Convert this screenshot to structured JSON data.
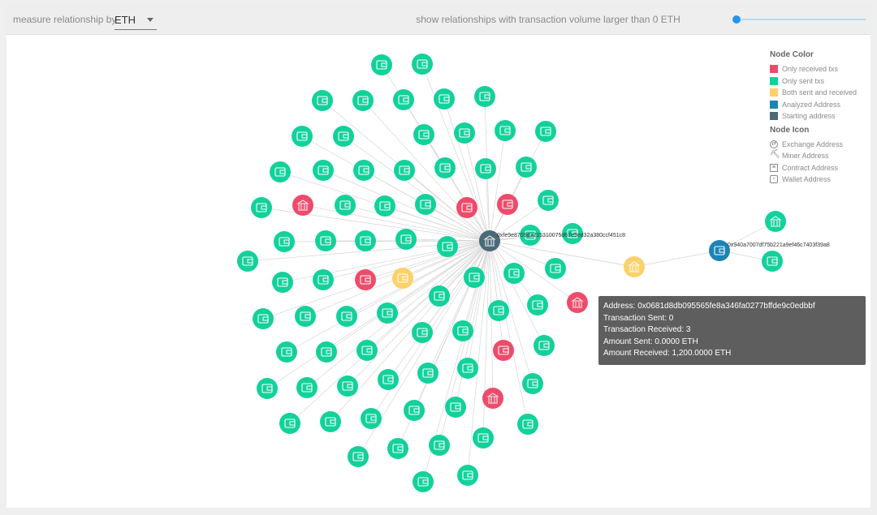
{
  "toolbar": {
    "measure_label": "measure relationship by",
    "measure_value": "ETH",
    "volume_text": "show relationships with transaction volume larger than 0 ETH",
    "slider_value": 0
  },
  "legend": {
    "color_title": "Node Color",
    "colors": [
      {
        "label": "Only received txs",
        "color": "#ee4b6b"
      },
      {
        "label": "Only sent txs",
        "color": "#13d19b"
      },
      {
        "label": "Both sent and received",
        "color": "#fcd06b"
      },
      {
        "label": "Analyzed Address",
        "color": "#1a85b4"
      },
      {
        "label": "Starting address",
        "color": "#4a6a77"
      }
    ],
    "icon_title": "Node Icon",
    "icons": [
      {
        "label": "Exchange Address",
        "icon": "exchange-icon"
      },
      {
        "label": "Miner Address",
        "icon": "miner-icon"
      },
      {
        "label": "Contract Address",
        "icon": "contract-icon"
      },
      {
        "label": "Wallet Address",
        "icon": "wallet-icon"
      }
    ]
  },
  "graph": {
    "hub_label": "0xfe9e8709d3215310075d67e3ed32a380ccf451c8",
    "analyzed_label": "0x940a7007df75b221a9ef46c7403f39a8"
  },
  "tooltip": {
    "address": "Address: 0x0681d8db095565fe8a346fa0277bffde9c0edbbf",
    "sent": "Transaction Sent: 0",
    "received": "Transaction Received: 3",
    "amount_sent": "Amount Sent: 0.0000 ETH",
    "amount_received": "Amount Received: 1,200.0000 ETH"
  }
}
